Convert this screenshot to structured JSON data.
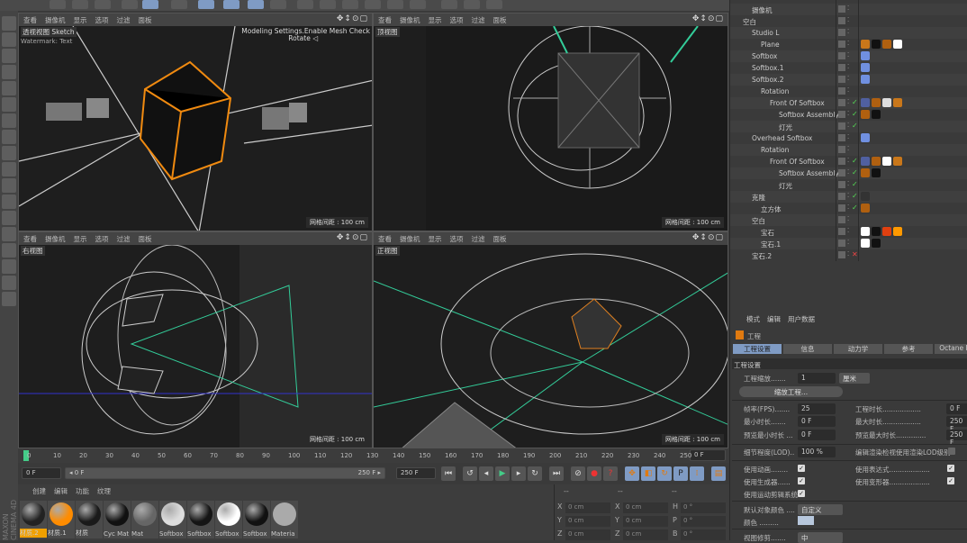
{
  "viewports": [
    {
      "menu": [
        "查看",
        "摄像机",
        "显示",
        "选项",
        "过滤",
        "面板"
      ],
      "label": "透视视图",
      "mode": "Sketch",
      "watermark": "Watermark: Text",
      "overlay1": "Modeling Settings.Enable Mesh Check",
      "overlay2": "Rotate ◁",
      "grid": "网格间距 : 100 cm"
    },
    {
      "menu": [
        "查看",
        "摄像机",
        "显示",
        "选项",
        "过滤",
        "面板"
      ],
      "label": "顶视图",
      "grid": "网格间距 : 100 cm"
    },
    {
      "menu": [
        "查看",
        "摄像机",
        "显示",
        "选项",
        "过滤",
        "面板"
      ],
      "label": "右视图",
      "grid": "网格间距 : 100 cm"
    },
    {
      "menu": [
        "查看",
        "摄像机",
        "显示",
        "选项",
        "过滤",
        "面板"
      ],
      "label": "正视图",
      "grid": "网格间距 : 100 cm"
    }
  ],
  "timeline": {
    "ticks": [
      "0",
      "10",
      "20",
      "30",
      "40",
      "50",
      "60",
      "70",
      "80",
      "90",
      "100",
      "110",
      "120",
      "130",
      "140",
      "150",
      "160",
      "170",
      "180",
      "190",
      "200",
      "210",
      "220",
      "230",
      "240",
      "250"
    ],
    "current": "0 F",
    "start": "0 F",
    "range_start": "◂ 0 F",
    "range_end": "250 F ▸",
    "end": "250 F"
  },
  "materials": {
    "menu": [
      "创建",
      "编辑",
      "功能",
      "纹理"
    ],
    "items": [
      {
        "name": "材质.2",
        "color": "#222",
        "selected": true
      },
      {
        "name": "材质.1",
        "color": "#ff8c00"
      },
      {
        "name": "材质",
        "color": "#1a1a1a"
      },
      {
        "name": "Cyc Mat",
        "color": "#111"
      },
      {
        "name": "Mat",
        "color": "#666"
      },
      {
        "name": "Softbox",
        "color": "#ddd"
      },
      {
        "name": "Softbox",
        "color": "#151515"
      },
      {
        "name": "Softbox",
        "color": "#fff"
      },
      {
        "name": "Softbox",
        "color": "#111"
      },
      {
        "name": "Materia",
        "color": "#aaa"
      }
    ]
  },
  "coords": {
    "headers": [
      "--",
      "--",
      "--"
    ],
    "rows": [
      [
        "X",
        "0 cm",
        "X",
        "0 cm",
        "H",
        "0 °"
      ],
      [
        "Y",
        "0 cm",
        "Y",
        "0 cm",
        "P",
        "0 °"
      ],
      [
        "Z",
        "0 cm",
        "Z",
        "0 cm",
        "B",
        "0 °"
      ]
    ]
  },
  "objects": [
    {
      "name": "摄像机",
      "indent": 1
    },
    {
      "name": "空白",
      "indent": 0
    },
    {
      "name": "Studio L",
      "indent": 1
    },
    {
      "name": "Plane",
      "indent": 2,
      "tags": [
        "#c9771a",
        "#111",
        "#b06010",
        "#fff"
      ]
    },
    {
      "name": "Softbox",
      "indent": 1,
      "tags": [
        "#7090e0"
      ]
    },
    {
      "name": "Softbox.1",
      "indent": 1,
      "tags": [
        "#7090e0"
      ]
    },
    {
      "name": "Softbox.2",
      "indent": 1,
      "tags": [
        "#7090e0"
      ]
    },
    {
      "name": "Rotation",
      "indent": 2
    },
    {
      "name": "Front Of Softbox",
      "indent": 3,
      "check": "✓",
      "tags": [
        "#5060a0",
        "#b06010",
        "#ddd",
        "#c9771a"
      ]
    },
    {
      "name": "Softbox Assembly",
      "indent": 4,
      "check": "✓",
      "tags": [
        "#b06010",
        "#111"
      ]
    },
    {
      "name": "灯光",
      "indent": 4,
      "check": "✓"
    },
    {
      "name": "Overhead Softbox",
      "indent": 1,
      "tags": [
        "#7090e0"
      ]
    },
    {
      "name": "Rotation",
      "indent": 2
    },
    {
      "name": "Front Of Softbox",
      "indent": 3,
      "check": "✓",
      "tags": [
        "#5060a0",
        "#b06010",
        "#fff",
        "#c9771a"
      ]
    },
    {
      "name": "Softbox Assembly",
      "indent": 4,
      "check": "✓",
      "tags": [
        "#b06010",
        "#111"
      ]
    },
    {
      "name": "灯光",
      "indent": 4,
      "check": "✓"
    },
    {
      "name": "克隆",
      "indent": 1,
      "check": "✓",
      "tags": [
        "#333"
      ]
    },
    {
      "name": "立方体",
      "indent": 2,
      "check": "✓",
      "tags": [
        "#b06010"
      ]
    },
    {
      "name": "空白",
      "indent": 1
    },
    {
      "name": "宝石",
      "indent": 2,
      "tags": [
        "#fff",
        "#111",
        "#e04010",
        "#ff9900"
      ]
    },
    {
      "name": "宝石.1",
      "indent": 2,
      "tags": [
        "#fff",
        "#111"
      ]
    },
    {
      "name": "宝石.2",
      "indent": 1,
      "check": "✕"
    }
  ],
  "attributes": {
    "menu": [
      "模式",
      "编辑",
      "用户数据"
    ],
    "title": "工程",
    "tabs": [
      "工程设置",
      "信息",
      "动力学",
      "参考",
      "Octane Ren"
    ],
    "section": "工程设置",
    "scale_label": "工程缩放.......",
    "scale": "1",
    "unit": "厘米",
    "scale_btn": "缩放工程...",
    "fps_label": "帧率(FPS).......",
    "fps": "25",
    "min_label": "最小时长.......",
    "min": "0 F",
    "pmin_label": "预览最小时长 ...",
    "pmin": "0 F",
    "dur_label": "工程时长..................",
    "dur": "0 F",
    "max_label": "最大时长..................",
    "max": "250 F",
    "pmax_label": "预览最大时长..............",
    "pmax": "250 F",
    "lod_label": "细节程度(LOD)..",
    "lod": "100 %",
    "lodr_label": "编辑渲染检视使用渲染LOD级别",
    "anim": "使用动画........",
    "gen": "使用生成器......",
    "motion": "使用运动剪辑系统",
    "expr": "使用表达式...................",
    "deform": "使用变形器...................",
    "defcol_label": "默认对象颜色 ....",
    "defcol": "自定义",
    "color_label": "颜色 .........",
    "color": "#b7c7dc",
    "clip_label": "视图修剪.......",
    "clip": "中"
  },
  "brand": "MAXON CINEMA 4D"
}
